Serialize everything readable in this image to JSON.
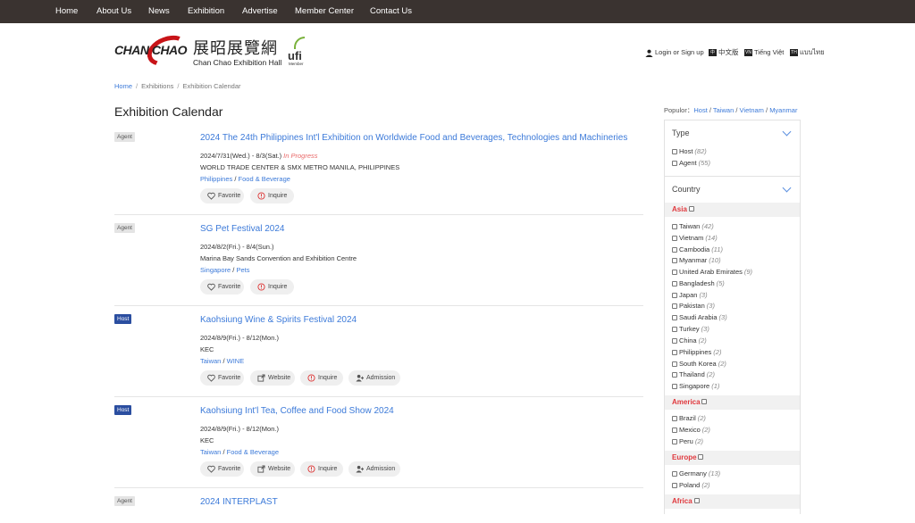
{
  "nav": {
    "home": "Home",
    "about": "About Us",
    "news": "News",
    "exhibition": "Exhibition",
    "advertise": "Advertise",
    "member": "Member Center",
    "contact": "Contact Us"
  },
  "logo": {
    "brand": "CHAN CHAO",
    "chinese": "展昭展覽網",
    "english": "Chan Chao Exhibition Hall",
    "ufi": "ufi",
    "ufi_member": "Member"
  },
  "util": {
    "login": "Login or Sign up",
    "lang_zh": "中文版",
    "lang_vi": "Tiếng Việt",
    "lang_th": "แบบไทย",
    "flag_zh": "中",
    "flag_vi": "VN",
    "flag_th": "TH"
  },
  "breadcrumb": {
    "home": "Home",
    "exhibitions": "Exhibitions",
    "current": "Exhibition Calendar",
    "sep": "/"
  },
  "page_title": "Exhibition Calendar",
  "events": [
    {
      "tag": "Agent",
      "title": "2024 The 24th Philippines Int'l Exhibition on Worldwide Food and Beverages, Technologies and Machineries",
      "date": "2024/7/31(Wed.) - 8/3(Sat.)",
      "status": "In Progress",
      "venue": "WORLD TRADE CENTER & SMX METRO MANILA, PHILIPPINES",
      "country": "Philippines",
      "category": "Food & Beverage",
      "favorite": "Favorite",
      "inquire": "Inquire"
    },
    {
      "tag": "Agent",
      "title": "SG Pet Festival 2024",
      "date": "2024/8/2(Fri.) - 8/4(Sun.)",
      "venue": "Marina Bay Sands Convention and Exhibition Centre",
      "country": "Singapore",
      "category": "Pets",
      "favorite": "Favorite",
      "inquire": "Inquire"
    },
    {
      "tag": "Host",
      "title": "Kaohsiung Wine & Spirits Festival 2024",
      "date": "2024/8/9(Fri.) - 8/12(Mon.)",
      "venue": "KEC",
      "country": "Taiwan",
      "category": "WINE",
      "favorite": "Favorite",
      "website": "Website",
      "inquire": "Inquire",
      "admission": "Admission"
    },
    {
      "tag": "Host",
      "title": "Kaohsiung Int'l Tea, Coffee and Food Show 2024",
      "date": "2024/8/9(Fri.) - 8/12(Mon.)",
      "venue": "KEC",
      "country": "Taiwan",
      "category": "Food & Beverage",
      "favorite": "Favorite",
      "website": "Website",
      "inquire": "Inquire",
      "admission": "Admission"
    },
    {
      "tag": "Agent",
      "title": "2024 INTERPLAST"
    }
  ],
  "popular": {
    "label": "Populor：",
    "host": "Host",
    "taiwan": "Taiwan",
    "vietnam": "Vietnam",
    "myanmar": "Myanmar"
  },
  "filters": {
    "type_heading": "Type",
    "types": [
      {
        "label": "Host",
        "count": "(82)"
      },
      {
        "label": "Agent",
        "count": "(55)"
      }
    ],
    "country_heading": "Country",
    "asia": "Asia",
    "asia_countries": [
      {
        "label": "Taiwan",
        "count": "(42)"
      },
      {
        "label": "Vietnam",
        "count": "(14)"
      },
      {
        "label": "Cambodia",
        "count": "(11)"
      },
      {
        "label": "Myanmar",
        "count": "(10)"
      },
      {
        "label": "United Arab Emirates",
        "count": "(9)"
      },
      {
        "label": "Bangladesh",
        "count": "(5)"
      },
      {
        "label": "Japan",
        "count": "(3)"
      },
      {
        "label": "Pakistan",
        "count": "(3)"
      },
      {
        "label": "Saudi Arabia",
        "count": "(3)"
      },
      {
        "label": "Turkey",
        "count": "(3)"
      },
      {
        "label": "China",
        "count": "(2)"
      },
      {
        "label": "Philippines",
        "count": "(2)"
      },
      {
        "label": "South Korea",
        "count": "(2)"
      },
      {
        "label": "Thailand",
        "count": "(2)"
      },
      {
        "label": "Singapore",
        "count": "(1)"
      }
    ],
    "america": "America",
    "america_countries": [
      {
        "label": "Brazil",
        "count": "(2)"
      },
      {
        "label": "Mexico",
        "count": "(2)"
      },
      {
        "label": "Peru",
        "count": "(2)"
      }
    ],
    "europe": "Europe",
    "europe_countries": [
      {
        "label": "Germany",
        "count": "(13)"
      },
      {
        "label": "Poland",
        "count": "(2)"
      }
    ],
    "africa": "Africa"
  }
}
